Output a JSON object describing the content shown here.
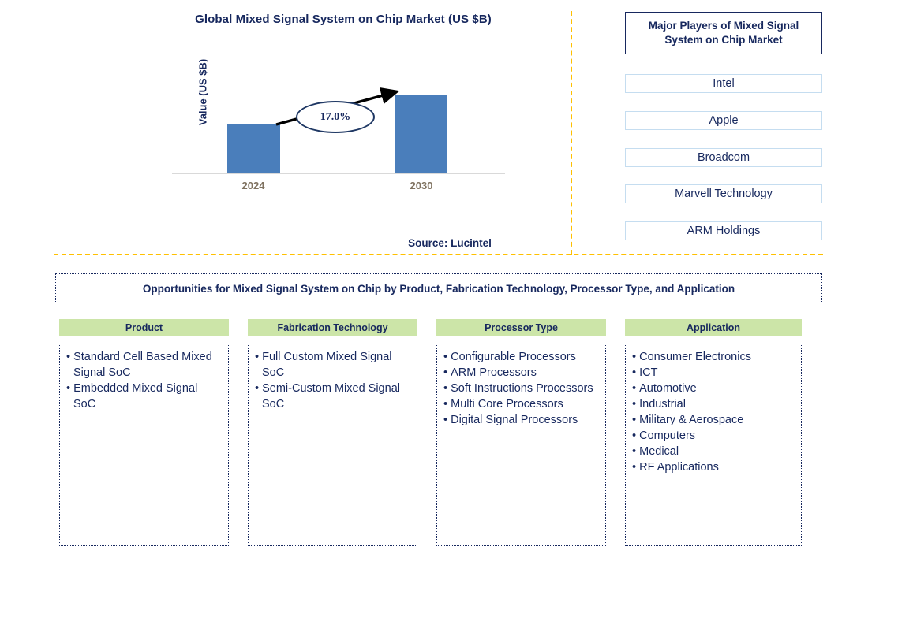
{
  "chart_panel": {
    "title": "Global Mixed Signal System on Chip Market (US $B)",
    "source": "Source: Lucintel"
  },
  "chart_data": {
    "type": "bar",
    "title": "Global Mixed Signal System on Chip Market (US $B)",
    "categories": [
      "2024",
      "2030"
    ],
    "values": [
      63,
      99
    ],
    "xlabel": "",
    "ylabel": "Value (US $B)",
    "annotations": [
      {
        "label": "17.0%",
        "type": "cagr-callout",
        "from": "2024",
        "to": "2030"
      }
    ],
    "grid": false,
    "legend": false,
    "bar_color": "#4A7EBB",
    "tick_label_color": "#7F7260",
    "axis_label_color": "#17285E"
  },
  "players_panel": {
    "header": "Major Players of Mixed Signal System on Chip Market",
    "items": [
      {
        "label": "Intel"
      },
      {
        "label": "Apple"
      },
      {
        "label": "Broadcom"
      },
      {
        "label": "Marvell Technology"
      },
      {
        "label": "ARM Holdings"
      }
    ]
  },
  "opportunities": {
    "banner": "Opportunities for Mixed Signal System on Chip by Product, Fabrication Technology, Processor Type, and Application",
    "columns": [
      {
        "header": "Product",
        "items": [
          "Standard Cell Based Mixed Signal SoC",
          "Embedded Mixed Signal SoC"
        ]
      },
      {
        "header": "Fabrication Technology",
        "items": [
          "Full Custom Mixed Signal SoC",
          "Semi-Custom Mixed Signal SoC"
        ]
      },
      {
        "header": "Processor Type",
        "items": [
          "Configurable Processors",
          "ARM Processors",
          "Soft Instructions Processors",
          "Multi Core Processors",
          "Digital Signal Processors"
        ]
      },
      {
        "header": "Application",
        "items": [
          "Consumer Electronics",
          "ICT",
          "Automotive",
          "Industrial",
          "Military & Aerospace",
          "Computers",
          "Medical",
          "RF Applications"
        ]
      }
    ]
  },
  "colors": {
    "navy": "#17285E",
    "bar_blue": "#4A7EBB",
    "divider_gold": "#FFC000",
    "header_green": "#CCE5A8",
    "player_border": "#C5DDF0"
  }
}
